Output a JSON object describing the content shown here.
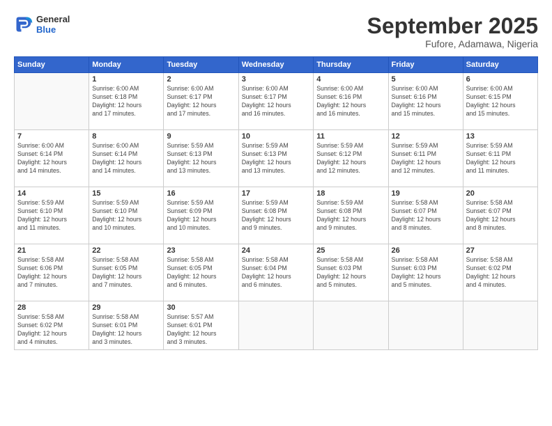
{
  "logo": {
    "general": "General",
    "blue": "Blue"
  },
  "title": "September 2025",
  "location": "Fufore, Adamawa, Nigeria",
  "days_of_week": [
    "Sunday",
    "Monday",
    "Tuesday",
    "Wednesday",
    "Thursday",
    "Friday",
    "Saturday"
  ],
  "weeks": [
    [
      {
        "day": "",
        "info": ""
      },
      {
        "day": "1",
        "info": "Sunrise: 6:00 AM\nSunset: 6:18 PM\nDaylight: 12 hours\nand 17 minutes."
      },
      {
        "day": "2",
        "info": "Sunrise: 6:00 AM\nSunset: 6:17 PM\nDaylight: 12 hours\nand 17 minutes."
      },
      {
        "day": "3",
        "info": "Sunrise: 6:00 AM\nSunset: 6:17 PM\nDaylight: 12 hours\nand 16 minutes."
      },
      {
        "day": "4",
        "info": "Sunrise: 6:00 AM\nSunset: 6:16 PM\nDaylight: 12 hours\nand 16 minutes."
      },
      {
        "day": "5",
        "info": "Sunrise: 6:00 AM\nSunset: 6:16 PM\nDaylight: 12 hours\nand 15 minutes."
      },
      {
        "day": "6",
        "info": "Sunrise: 6:00 AM\nSunset: 6:15 PM\nDaylight: 12 hours\nand 15 minutes."
      }
    ],
    [
      {
        "day": "7",
        "info": "Sunrise: 6:00 AM\nSunset: 6:14 PM\nDaylight: 12 hours\nand 14 minutes."
      },
      {
        "day": "8",
        "info": "Sunrise: 6:00 AM\nSunset: 6:14 PM\nDaylight: 12 hours\nand 14 minutes."
      },
      {
        "day": "9",
        "info": "Sunrise: 5:59 AM\nSunset: 6:13 PM\nDaylight: 12 hours\nand 13 minutes."
      },
      {
        "day": "10",
        "info": "Sunrise: 5:59 AM\nSunset: 6:13 PM\nDaylight: 12 hours\nand 13 minutes."
      },
      {
        "day": "11",
        "info": "Sunrise: 5:59 AM\nSunset: 6:12 PM\nDaylight: 12 hours\nand 12 minutes."
      },
      {
        "day": "12",
        "info": "Sunrise: 5:59 AM\nSunset: 6:11 PM\nDaylight: 12 hours\nand 12 minutes."
      },
      {
        "day": "13",
        "info": "Sunrise: 5:59 AM\nSunset: 6:11 PM\nDaylight: 12 hours\nand 11 minutes."
      }
    ],
    [
      {
        "day": "14",
        "info": "Sunrise: 5:59 AM\nSunset: 6:10 PM\nDaylight: 12 hours\nand 11 minutes."
      },
      {
        "day": "15",
        "info": "Sunrise: 5:59 AM\nSunset: 6:10 PM\nDaylight: 12 hours\nand 10 minutes."
      },
      {
        "day": "16",
        "info": "Sunrise: 5:59 AM\nSunset: 6:09 PM\nDaylight: 12 hours\nand 10 minutes."
      },
      {
        "day": "17",
        "info": "Sunrise: 5:59 AM\nSunset: 6:08 PM\nDaylight: 12 hours\nand 9 minutes."
      },
      {
        "day": "18",
        "info": "Sunrise: 5:59 AM\nSunset: 6:08 PM\nDaylight: 12 hours\nand 9 minutes."
      },
      {
        "day": "19",
        "info": "Sunrise: 5:58 AM\nSunset: 6:07 PM\nDaylight: 12 hours\nand 8 minutes."
      },
      {
        "day": "20",
        "info": "Sunrise: 5:58 AM\nSunset: 6:07 PM\nDaylight: 12 hours\nand 8 minutes."
      }
    ],
    [
      {
        "day": "21",
        "info": "Sunrise: 5:58 AM\nSunset: 6:06 PM\nDaylight: 12 hours\nand 7 minutes."
      },
      {
        "day": "22",
        "info": "Sunrise: 5:58 AM\nSunset: 6:05 PM\nDaylight: 12 hours\nand 7 minutes."
      },
      {
        "day": "23",
        "info": "Sunrise: 5:58 AM\nSunset: 6:05 PM\nDaylight: 12 hours\nand 6 minutes."
      },
      {
        "day": "24",
        "info": "Sunrise: 5:58 AM\nSunset: 6:04 PM\nDaylight: 12 hours\nand 6 minutes."
      },
      {
        "day": "25",
        "info": "Sunrise: 5:58 AM\nSunset: 6:03 PM\nDaylight: 12 hours\nand 5 minutes."
      },
      {
        "day": "26",
        "info": "Sunrise: 5:58 AM\nSunset: 6:03 PM\nDaylight: 12 hours\nand 5 minutes."
      },
      {
        "day": "27",
        "info": "Sunrise: 5:58 AM\nSunset: 6:02 PM\nDaylight: 12 hours\nand 4 minutes."
      }
    ],
    [
      {
        "day": "28",
        "info": "Sunrise: 5:58 AM\nSunset: 6:02 PM\nDaylight: 12 hours\nand 4 minutes."
      },
      {
        "day": "29",
        "info": "Sunrise: 5:58 AM\nSunset: 6:01 PM\nDaylight: 12 hours\nand 3 minutes."
      },
      {
        "day": "30",
        "info": "Sunrise: 5:57 AM\nSunset: 6:01 PM\nDaylight: 12 hours\nand 3 minutes."
      },
      {
        "day": "",
        "info": ""
      },
      {
        "day": "",
        "info": ""
      },
      {
        "day": "",
        "info": ""
      },
      {
        "day": "",
        "info": ""
      }
    ]
  ]
}
